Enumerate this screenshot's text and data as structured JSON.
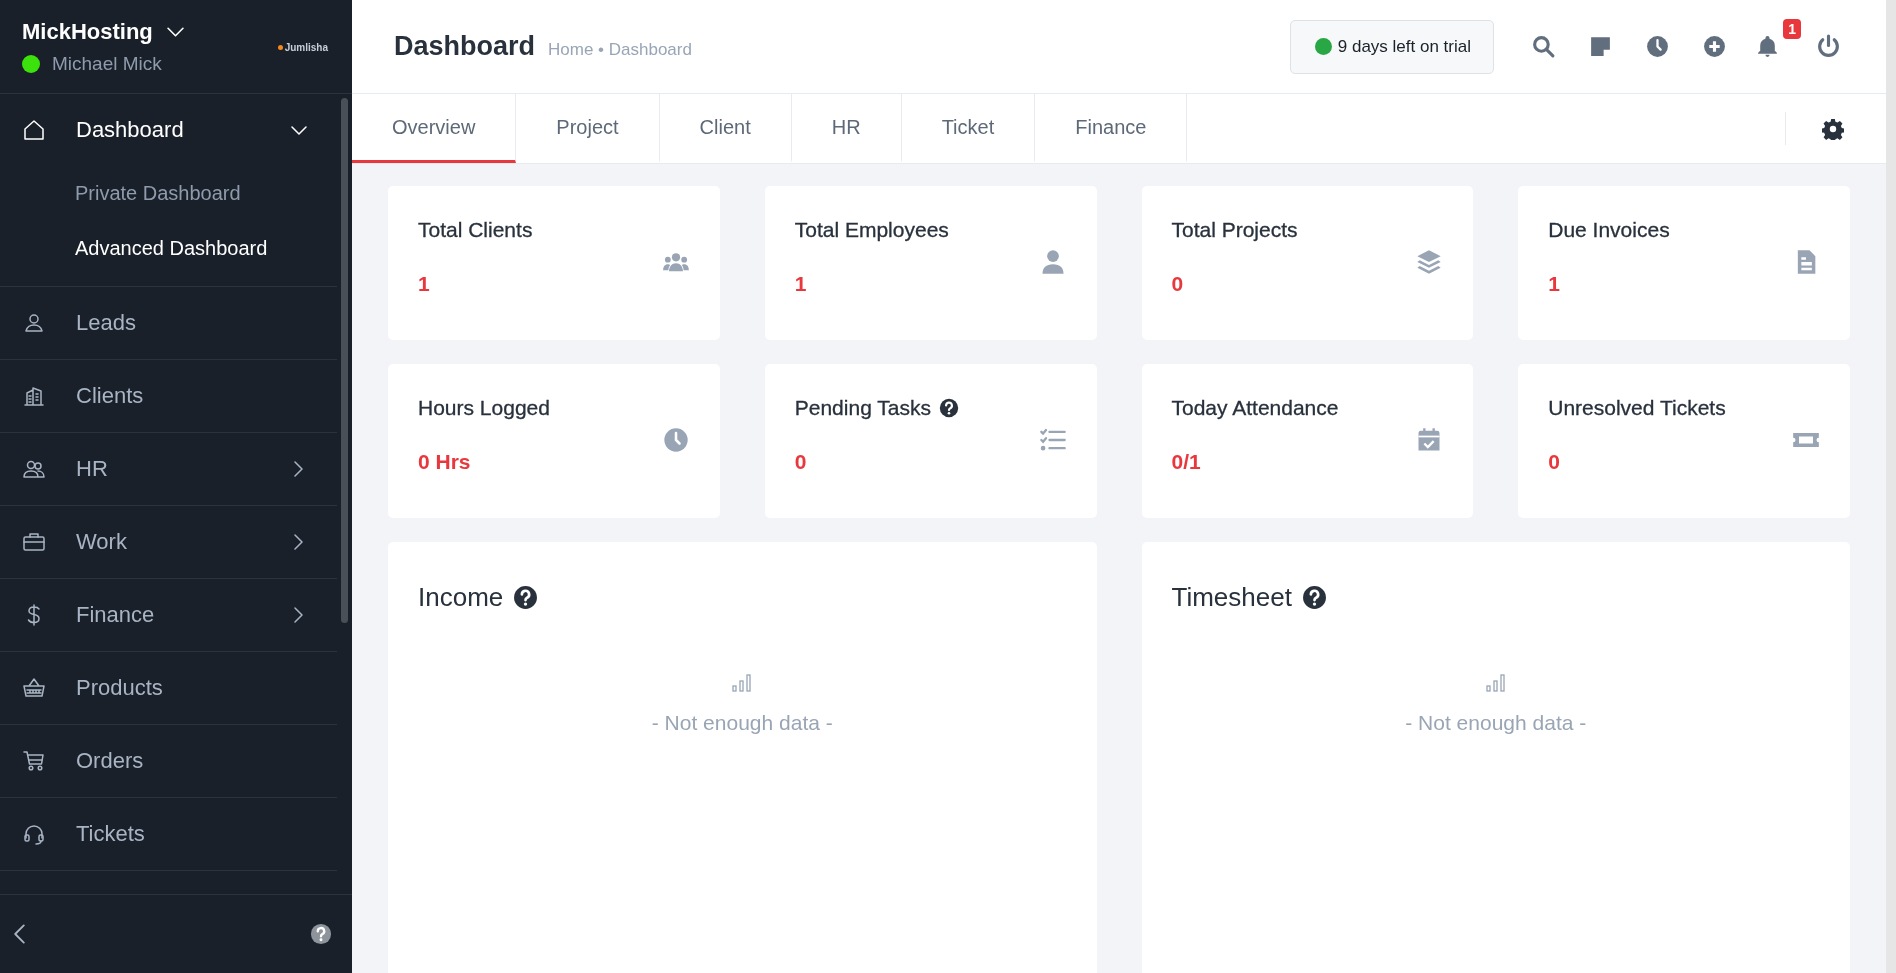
{
  "sidebar": {
    "company": "MickHosting",
    "user": {
      "name": "Michael Mick",
      "online": true
    },
    "logo_text": "Jumlisha",
    "menu": [
      {
        "label": "Dashboard",
        "kind": "home",
        "submenu": true,
        "expanded": true,
        "children": [
          {
            "label": "Private Dashboard",
            "selected": false
          },
          {
            "label": "Advanced Dashboard",
            "selected": true
          }
        ]
      },
      {
        "label": "Leads",
        "kind": "user",
        "submenu": false,
        "expanded": false
      },
      {
        "label": "Clients",
        "kind": "building",
        "submenu": false,
        "expanded": false
      },
      {
        "label": "HR",
        "kind": "people",
        "submenu": true,
        "expanded": false
      },
      {
        "label": "Work",
        "kind": "briefcase",
        "submenu": true,
        "expanded": false
      },
      {
        "label": "Finance",
        "kind": "dollar",
        "submenu": true,
        "expanded": false
      },
      {
        "label": "Products",
        "kind": "basket",
        "submenu": false,
        "expanded": false
      },
      {
        "label": "Orders",
        "kind": "cart",
        "submenu": false,
        "expanded": false
      },
      {
        "label": "Tickets",
        "kind": "headset",
        "submenu": false,
        "expanded": false
      }
    ]
  },
  "topbar": {
    "title": "Dashboard",
    "breadcrumb": "Home • Dashboard",
    "trial": {
      "text": "9 days left on trial",
      "active": true
    },
    "notification_count": "1"
  },
  "tabs": [
    {
      "label": "Overview",
      "selected": true
    },
    {
      "label": "Project",
      "selected": false
    },
    {
      "label": "Client",
      "selected": false
    },
    {
      "label": "HR",
      "selected": false
    },
    {
      "label": "Ticket",
      "selected": false
    },
    {
      "label": "Finance",
      "selected": false
    }
  ],
  "stats": [
    {
      "title": "Total Clients",
      "value": "1",
      "kind": "users",
      "help": false
    },
    {
      "title": "Total Employees",
      "value": "1",
      "kind": "person",
      "help": false
    },
    {
      "title": "Total Projects",
      "value": "0",
      "kind": "layers",
      "help": false
    },
    {
      "title": "Due Invoices",
      "value": "1",
      "kind": "file",
      "help": false
    },
    {
      "title": "Hours Logged",
      "value": "0 Hrs",
      "kind": "clock",
      "help": false
    },
    {
      "title": "Pending Tasks",
      "value": "0",
      "kind": "tasks",
      "help": true
    },
    {
      "title": "Today Attendance",
      "value": "0/1",
      "kind": "calendar",
      "help": false
    },
    {
      "title": "Unresolved Tickets",
      "value": "0",
      "kind": "ticket",
      "help": false
    }
  ],
  "panels": [
    {
      "title": "Income",
      "help": true,
      "empty_text": "- Not enough data -"
    },
    {
      "title": "Timesheet",
      "help": true,
      "empty_text": "- Not enough data -"
    }
  ]
}
